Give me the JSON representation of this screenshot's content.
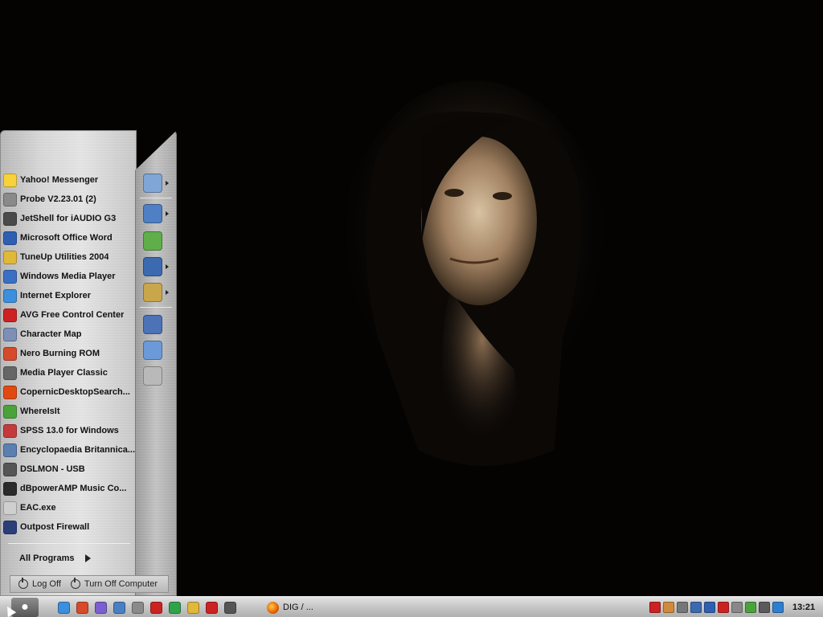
{
  "start_menu": {
    "pinned": [
      {
        "label": "Yahoo! Messenger",
        "icon": "yahoo-messenger-icon",
        "color": "#f7d23b"
      },
      {
        "label": "Probe V2.23.01 (2)",
        "icon": "probe-icon",
        "color": "#8a8a8a"
      },
      {
        "label": "JetShell for iAUDIO G3",
        "icon": "jetshell-icon",
        "color": "#4a4a4a"
      },
      {
        "label": "Microsoft Office Word",
        "icon": "word-icon",
        "color": "#2f5fb3"
      },
      {
        "label": "TuneUp Utilities 2004",
        "icon": "tuneup-icon",
        "color": "#e0b83a"
      },
      {
        "label": "Windows Media Player",
        "icon": "media-player-icon",
        "color": "#3a6fc4"
      },
      {
        "label": "Internet Explorer",
        "icon": "internet-explorer-icon",
        "color": "#3b8fdc"
      },
      {
        "label": "AVG Free Control Center",
        "icon": "avg-icon",
        "color": "#cc2222"
      },
      {
        "label": "Character Map",
        "icon": "character-map-icon",
        "color": "#7d8fb5"
      },
      {
        "label": "Nero Burning ROM",
        "icon": "nero-icon",
        "color": "#d44a2a"
      },
      {
        "label": "Media Player Classic",
        "icon": "media-player-classic-icon",
        "color": "#666666"
      },
      {
        "label": "CopernicDesktopSearch...",
        "icon": "copernic-icon",
        "color": "#e04a12"
      },
      {
        "label": "WhereIsIt",
        "icon": "whereisit-icon",
        "color": "#4aa33a"
      },
      {
        "label": "SPSS 13.0 for Windows",
        "icon": "spss-icon",
        "color": "#c43a3a"
      },
      {
        "label": "Encyclopaedia Britannica...",
        "icon": "britannica-icon",
        "color": "#5a7fb0"
      },
      {
        "label": "DSLMON - USB",
        "icon": "dslmon-icon",
        "color": "#555555"
      },
      {
        "label": "dBpowerAMP Music Co...",
        "icon": "dbpoweramp-icon",
        "color": "#2a2a2a"
      },
      {
        "label": "EAC.exe",
        "icon": "eac-icon",
        "color": "#cfcfcf"
      },
      {
        "label": "Outpost Firewall",
        "icon": "outpost-firewall-icon",
        "color": "#2a3f7a"
      }
    ],
    "all_programs_label": "All Programs",
    "log_off_label": "Log Off",
    "turn_off_label": "Turn Off Computer",
    "side_icons": [
      {
        "icon": "recent-documents-icon",
        "color": "#7fa6d6",
        "has_submenu": true
      },
      {
        "icon": "my-documents-icon",
        "color": "#4f7fc4",
        "has_submenu": true
      },
      {
        "icon": "control-panel-icon",
        "color": "#5fae4a",
        "has_submenu": false
      },
      {
        "icon": "my-computer-icon",
        "color": "#3c6ab0",
        "has_submenu": true
      },
      {
        "icon": "network-folder-icon",
        "color": "#c9a64a",
        "has_submenu": true
      },
      {
        "icon": "run-icon",
        "color": "#4c72b8",
        "has_submenu": false
      },
      {
        "icon": "search-icon",
        "color": "#6b9ad8",
        "has_submenu": false
      },
      {
        "icon": "help-icon",
        "color": "#b9b9b9",
        "has_submenu": false
      }
    ]
  },
  "taskbar": {
    "start_icon": "apple-icon",
    "quick_launch": [
      {
        "icon": "internet-explorer-icon",
        "color": "#3b8fdc"
      },
      {
        "icon": "flash-icon",
        "color": "#d94a2a"
      },
      {
        "icon": "media-icon",
        "color": "#7a5fd0"
      },
      {
        "icon": "book-icon",
        "color": "#4a7fc4"
      },
      {
        "icon": "settings-icon",
        "color": "#8a8a8a"
      },
      {
        "icon": "opera-icon",
        "color": "#cc2222"
      },
      {
        "icon": "green-app-icon",
        "color": "#2fa34a"
      },
      {
        "icon": "pencil-icon",
        "color": "#e0b83a"
      },
      {
        "icon": "firewall-icon",
        "color": "#cc2222"
      },
      {
        "icon": "disc-icon",
        "color": "#555555"
      }
    ],
    "task_label": "DIG / ...",
    "task_icon": "firefox-icon",
    "tray": [
      {
        "icon": "shield-icon",
        "color": "#cc2222"
      },
      {
        "icon": "tray-app-icon",
        "color": "#d08a3a"
      },
      {
        "icon": "monitor-icon",
        "color": "#777777"
      },
      {
        "icon": "network-icon",
        "color": "#3c6ab0"
      },
      {
        "icon": "globe-icon",
        "color": "#2f5fb3"
      },
      {
        "icon": "avg-icon",
        "color": "#cc2222"
      },
      {
        "icon": "speaker-icon",
        "color": "#888888"
      },
      {
        "icon": "messenger-icon",
        "color": "#4aa33a"
      },
      {
        "icon": "pen-icon",
        "color": "#5a5a5a"
      },
      {
        "icon": "help-icon",
        "color": "#2f7fd0"
      }
    ],
    "clock": "13:21"
  }
}
